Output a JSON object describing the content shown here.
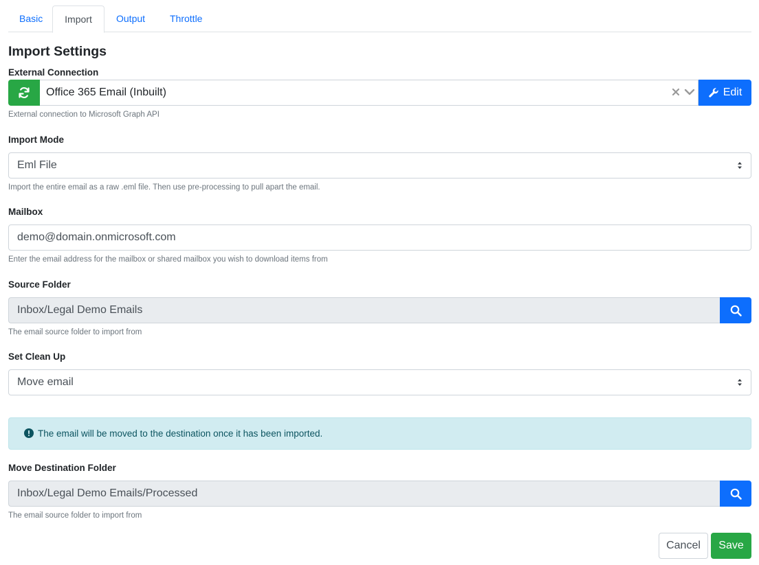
{
  "tabs": [
    {
      "label": "Basic",
      "active": false
    },
    {
      "label": "Import",
      "active": true
    },
    {
      "label": "Output",
      "active": false
    },
    {
      "label": "Throttle",
      "active": false
    }
  ],
  "section_title": "Import Settings",
  "external_connection": {
    "label": "External Connection",
    "value": "Office 365 Email (Inbuilt)",
    "edit_label": "Edit",
    "help": "External connection to Microsoft Graph API"
  },
  "import_mode": {
    "label": "Import Mode",
    "value": "Eml File",
    "help": "Import the entire email as a raw .eml file. Then use pre-processing to pull apart the email."
  },
  "mailbox": {
    "label": "Mailbox",
    "value": "demo@domain.onmicrosoft.com",
    "help": "Enter the email address for the mailbox or shared mailbox you wish to download items from"
  },
  "source_folder": {
    "label": "Source Folder",
    "value": "Inbox/Legal Demo Emails",
    "help": "The email source folder to import from"
  },
  "clean_up": {
    "label": "Set Clean Up",
    "value": "Move email"
  },
  "alert": {
    "text": "The email will be moved to the destination once it has been imported."
  },
  "move_destination": {
    "label": "Move Destination Folder",
    "value": "Inbox/Legal Demo Emails/Processed",
    "help": "The email source folder to import from"
  },
  "actions": {
    "cancel_label": "Cancel",
    "save_label": "Save"
  },
  "colors": {
    "primary": "#0d6efd",
    "success": "#28a745",
    "info_bg": "#d1ecf1",
    "info_text": "#0c5460"
  }
}
